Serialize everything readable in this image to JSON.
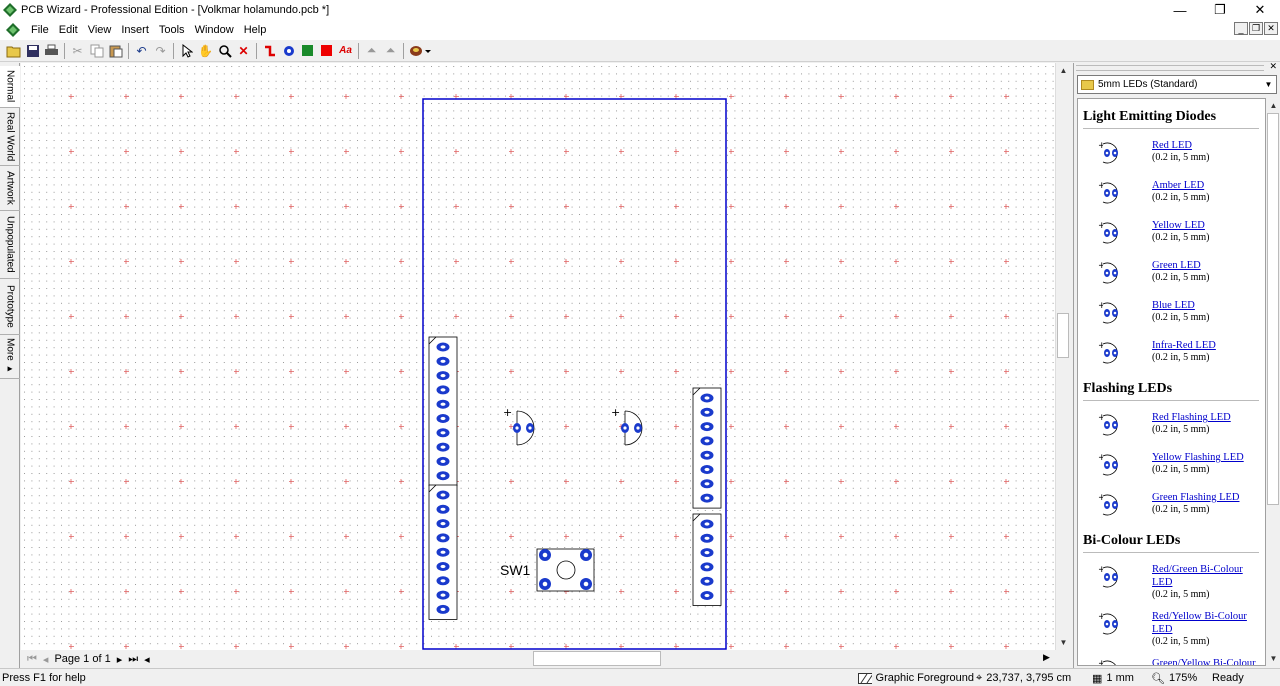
{
  "window": {
    "title": "PCB Wizard - Professional Edition - [Volkmar holamundo.pcb *]",
    "minimize": "—",
    "restore": "❐",
    "close": "✕"
  },
  "menu": {
    "items": [
      "File",
      "Edit",
      "View",
      "Insert",
      "Tools",
      "Window",
      "Help"
    ],
    "mdi_controls": [
      "_",
      "❐",
      "✕"
    ]
  },
  "toolbar": {
    "icons": [
      "open-icon",
      "save-icon",
      "print-icon",
      "cut-icon",
      "copy-icon",
      "paste-icon",
      "undo-icon",
      "redo-icon",
      "select-icon",
      "hand-icon",
      "zoom-icon",
      "delete-icon",
      "track-icon",
      "pad-icon",
      "green-rect-icon",
      "red-rect-icon",
      "text-icon",
      "flip-icon",
      "rotate-icon",
      "parts-icon"
    ]
  },
  "side_tabs": [
    "Normal",
    "Real World",
    "Artwork",
    "Unpopulated",
    "Prototype",
    "More ▸"
  ],
  "board": {
    "component_label": "SW1"
  },
  "page_nav": {
    "label": "Page 1 of 1"
  },
  "status": {
    "help": "Press F1 for help",
    "layer": "Graphic Foreground",
    "coords": "23,737, 3,795 cm",
    "grid": "1 mm",
    "zoom": "175%",
    "state": "Ready"
  },
  "parts_panel": {
    "library": "5mm LEDs (Standard)",
    "sections": [
      {
        "heading": "Light Emitting Diodes",
        "items": [
          {
            "name": "Red LED",
            "spec": "(0.2 in, 5 mm)"
          },
          {
            "name": "Amber LED",
            "spec": "(0.2 in, 5 mm)"
          },
          {
            "name": "Yellow LED",
            "spec": "(0.2 in, 5 mm)"
          },
          {
            "name": "Green LED",
            "spec": "(0.2 in, 5 mm)"
          },
          {
            "name": "Blue LED",
            "spec": "(0.2 in, 5 mm)"
          },
          {
            "name": "Infra-Red LED",
            "spec": "(0.2 in, 5 mm)"
          }
        ]
      },
      {
        "heading": "Flashing LEDs",
        "items": [
          {
            "name": "Red Flashing LED",
            "spec": "(0.2 in, 5 mm)"
          },
          {
            "name": "Yellow Flashing LED",
            "spec": "(0.2 in, 5 mm)"
          },
          {
            "name": "Green Flashing LED",
            "spec": "(0.2 in, 5 mm)"
          }
        ]
      },
      {
        "heading": "Bi-Colour LEDs",
        "items": [
          {
            "name": "Red/Green Bi-Colour LED",
            "spec": "(0.2 in, 5 mm)"
          },
          {
            "name": "Red/Yellow Bi-Colour LED",
            "spec": "(0.2 in, 5 mm)"
          },
          {
            "name": "Green/Yellow Bi-Colour",
            "spec": ""
          }
        ]
      }
    ]
  },
  "colors": {
    "board_outline": "#0000cc",
    "pad": "#0000cc",
    "grid_dot": "#a0a0a0",
    "grid_cross": "#e06060",
    "link": "#0000cc"
  }
}
